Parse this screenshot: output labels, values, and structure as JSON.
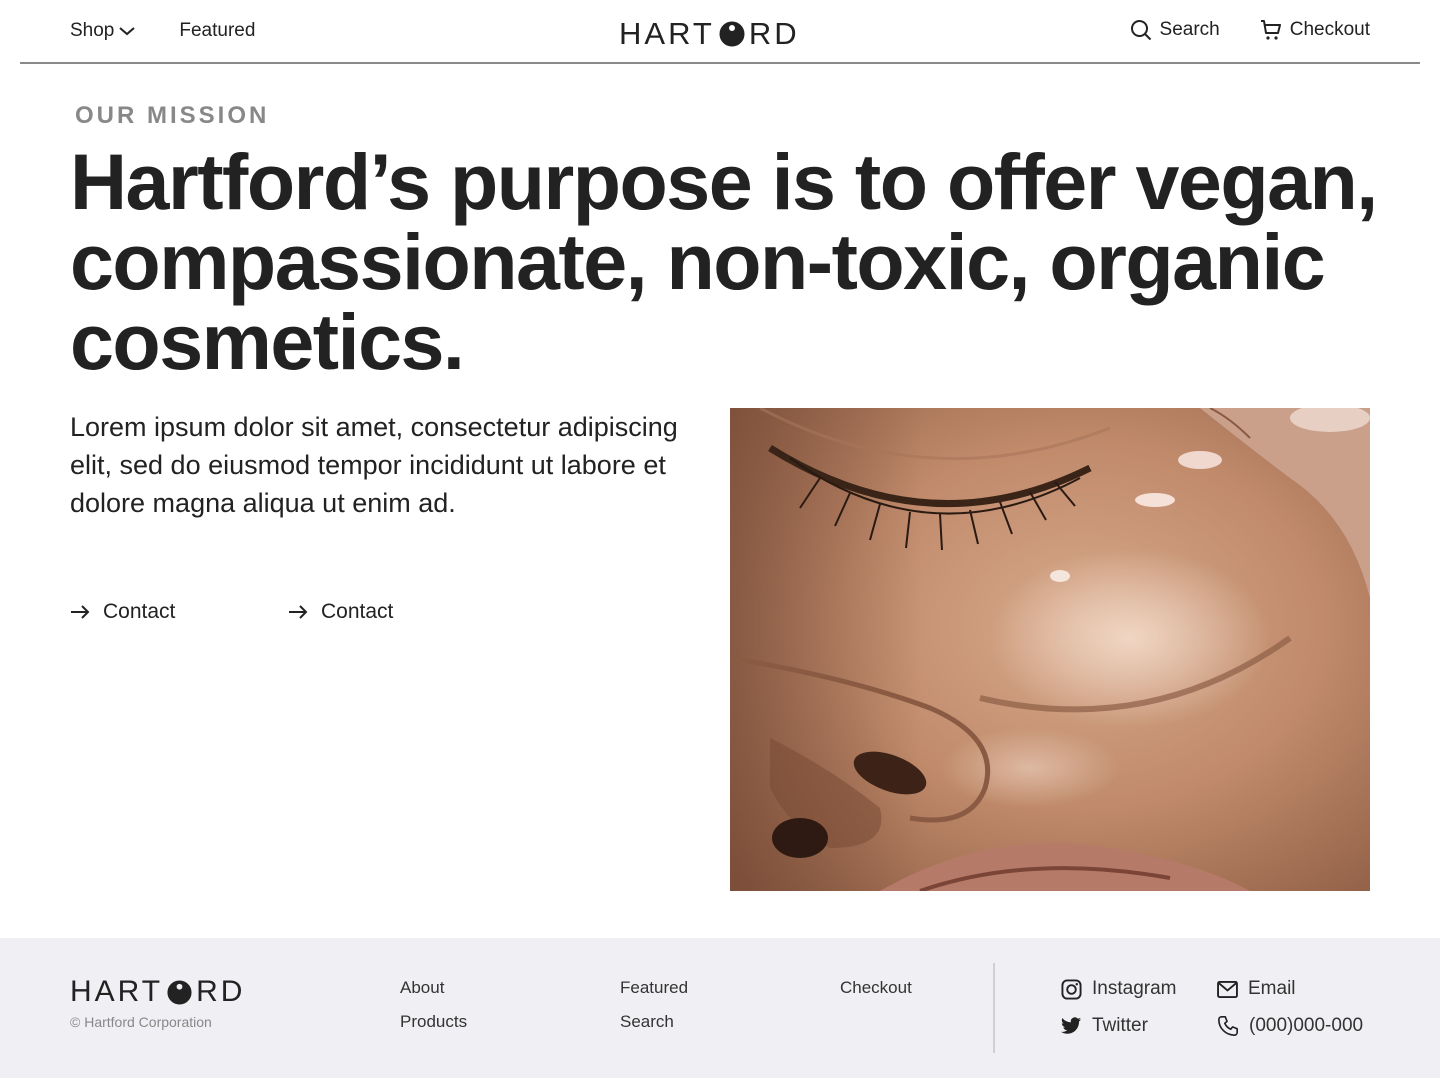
{
  "header": {
    "nav_left": {
      "shop": "Shop",
      "featured": "Featured"
    },
    "logo": {
      "before": "HART",
      "after": "RD"
    },
    "nav_right": {
      "search": "Search",
      "checkout": "Checkout"
    }
  },
  "hero": {
    "eyebrow": "OUR MISSION",
    "headline": "Hartford’s purpose is to offer vegan, compassionate, non-toxic, organic cosmetics.",
    "body": "Lorem ipsum dolor sit amet, consectetur adipiscing elit, sed do eiusmod tempor incididunt ut labore et dolore magna aliqua ut enim ad.",
    "ctas": [
      "Contact",
      "Contact"
    ]
  },
  "footer": {
    "logo": {
      "before": "HART",
      "after": "RD"
    },
    "copyright": "© Hartford Corporation",
    "links": {
      "col1": [
        "About",
        "Products"
      ],
      "col2": [
        "Featured",
        "Search"
      ],
      "col3": [
        "Checkout"
      ]
    },
    "social": {
      "instagram": "Instagram",
      "twitter": "Twitter",
      "email": "Email",
      "phone": "(000)000-000"
    }
  },
  "colors": {
    "text": "#222222",
    "muted": "#888888",
    "footer_bg": "#f0f0f4",
    "rule": "#8a8a8a"
  }
}
